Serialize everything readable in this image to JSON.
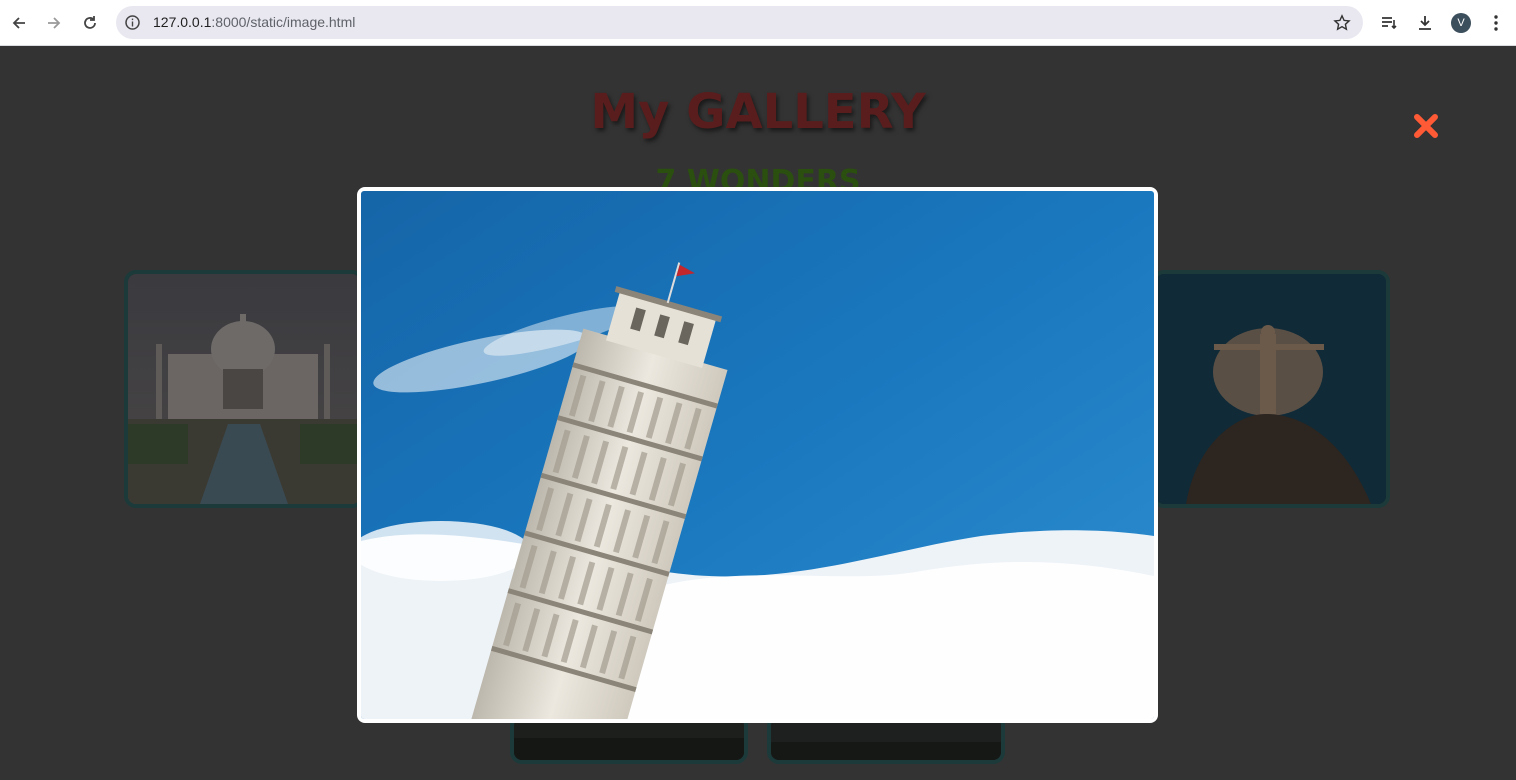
{
  "browser": {
    "url_host": "127.0.0.1",
    "url_path": ":8000/static/image.html",
    "avatar_letter": "V",
    "icons": [
      "back-icon",
      "forward-icon",
      "reload-icon",
      "info-icon",
      "star-icon",
      "tab-search-icon",
      "download-icon",
      "menu-icon"
    ]
  },
  "page": {
    "title": "My GALLERY",
    "subtitle": "7 WONDERS",
    "close_icon": "close-icon",
    "close_color": "#ff5a36",
    "title_color": "#5a1d1d",
    "subtitle_color": "#2a4f0f"
  },
  "gallery": {
    "thumbnails": [
      {
        "name": "Taj Mahal"
      },
      {
        "name": "Christ the Redeemer"
      },
      {
        "name": "bottom-left thumbnail"
      },
      {
        "name": "bottom-right thumbnail"
      }
    ]
  },
  "lightbox": {
    "image": "Leaning Tower of Pisa"
  }
}
